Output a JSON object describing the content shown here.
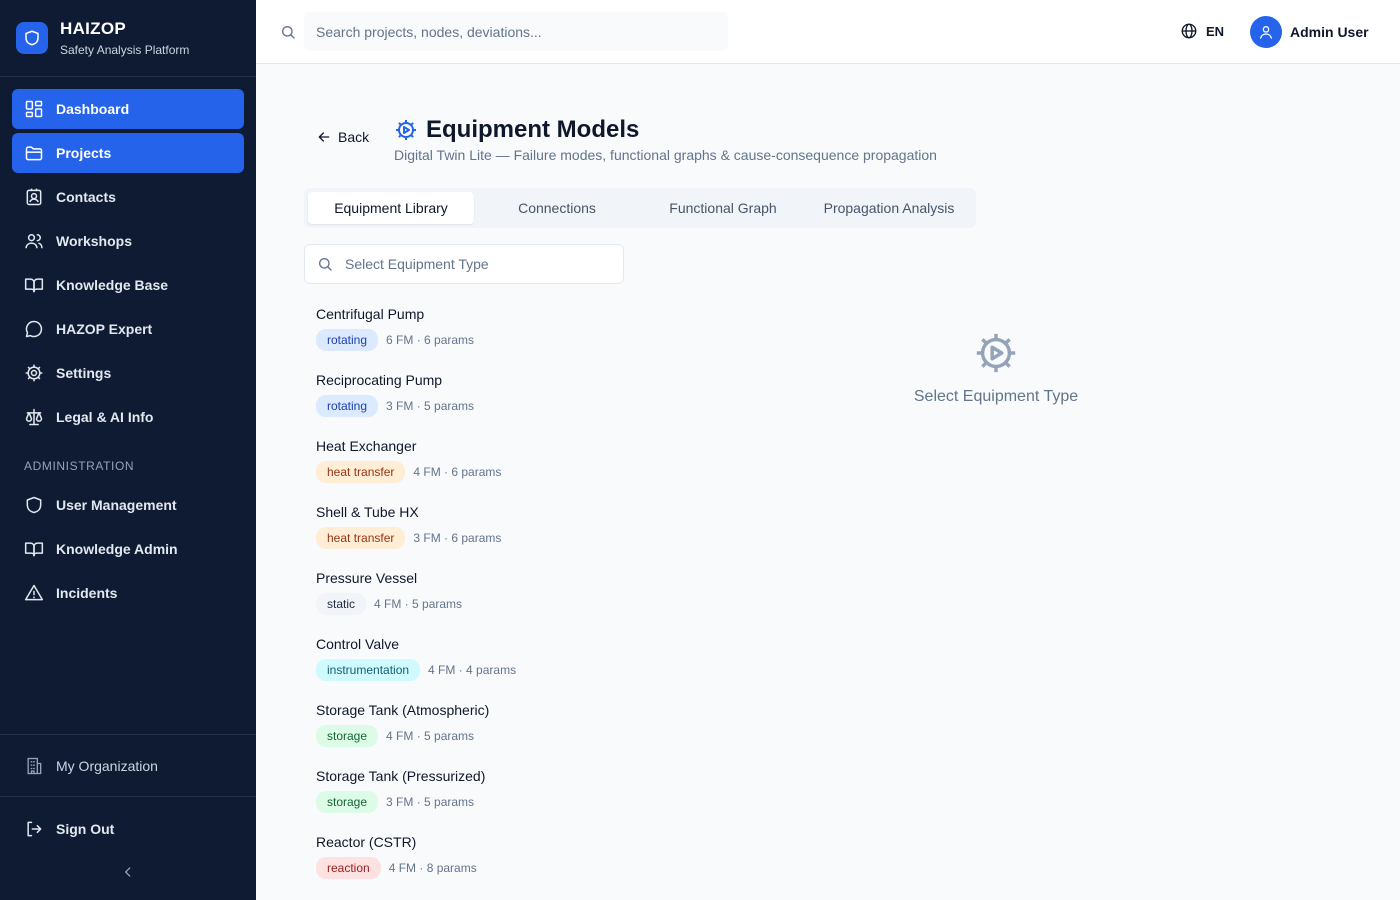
{
  "brand": {
    "title": "HAIZOP",
    "subtitle": "Safety Analysis Platform"
  },
  "nav": {
    "items": [
      {
        "label": "Dashboard",
        "icon": "dashboard-icon",
        "active": true
      },
      {
        "label": "Projects",
        "icon": "folder-icon",
        "active": true
      },
      {
        "label": "Contacts",
        "icon": "contacts-icon"
      },
      {
        "label": "Workshops",
        "icon": "users-icon"
      },
      {
        "label": "Knowledge Base",
        "icon": "book-icon"
      },
      {
        "label": "HAZOP Expert",
        "icon": "chat-icon"
      },
      {
        "label": "Settings",
        "icon": "gear-icon"
      },
      {
        "label": "Legal & AI Info",
        "icon": "scale-icon"
      }
    ],
    "admin_section": "ADMINISTRATION",
    "admin_items": [
      {
        "label": "User Management",
        "icon": "shield-icon"
      },
      {
        "label": "Knowledge Admin",
        "icon": "book-icon"
      },
      {
        "label": "Incidents",
        "icon": "warning-icon"
      }
    ],
    "organization": "My Organization",
    "sign_out": "Sign Out"
  },
  "header": {
    "search_placeholder": "Search projects, nodes, deviations...",
    "language": "EN",
    "user_name": "Admin User"
  },
  "page": {
    "back_label": "Back",
    "title": "Equipment Models",
    "subtitle": "Digital Twin Lite — Failure modes, functional graphs & cause-consequence propagation"
  },
  "tabs": [
    {
      "label": "Equipment Library",
      "active": true
    },
    {
      "label": "Connections"
    },
    {
      "label": "Functional Graph"
    },
    {
      "label": "Propagation Analysis"
    }
  ],
  "filter": {
    "placeholder": "Select Equipment Type"
  },
  "equipment": [
    {
      "name": "Centrifugal Pump",
      "category": "rotating",
      "stats": "6 FM · 6 params"
    },
    {
      "name": "Reciprocating Pump",
      "category": "rotating",
      "stats": "3 FM · 5 params"
    },
    {
      "name": "Heat Exchanger",
      "category": "heat transfer",
      "stats": "4 FM · 6 params"
    },
    {
      "name": "Shell & Tube HX",
      "category": "heat transfer",
      "stats": "3 FM · 6 params"
    },
    {
      "name": "Pressure Vessel",
      "category": "static",
      "stats": "4 FM · 5 params"
    },
    {
      "name": "Control Valve",
      "category": "instrumentation",
      "stats": "4 FM · 4 params"
    },
    {
      "name": "Storage Tank (Atmospheric)",
      "category": "storage",
      "stats": "4 FM · 5 params"
    },
    {
      "name": "Storage Tank (Pressurized)",
      "category": "storage",
      "stats": "3 FM · 5 params"
    },
    {
      "name": "Reactor (CSTR)",
      "category": "reaction",
      "stats": "4 FM · 8 params"
    }
  ],
  "category_colors": {
    "rotating": {
      "bg": "#dbeafe",
      "fg": "#1e40af"
    },
    "heat transfer": {
      "bg": "#ffedd5",
      "fg": "#9a3412"
    },
    "static": {
      "bg": "#f1f5f9",
      "fg": "#1e293b"
    },
    "instrumentation": {
      "bg": "#cffafe",
      "fg": "#155e75"
    },
    "storage": {
      "bg": "#dcfce7",
      "fg": "#166534"
    },
    "reaction": {
      "bg": "#fee2e2",
      "fg": "#991b1b"
    }
  },
  "empty_state": {
    "text": "Select Equipment Type",
    "icon": "gear-play-icon"
  },
  "colors": {
    "sidebar": "#0f1b33",
    "accent": "#2563eb"
  }
}
